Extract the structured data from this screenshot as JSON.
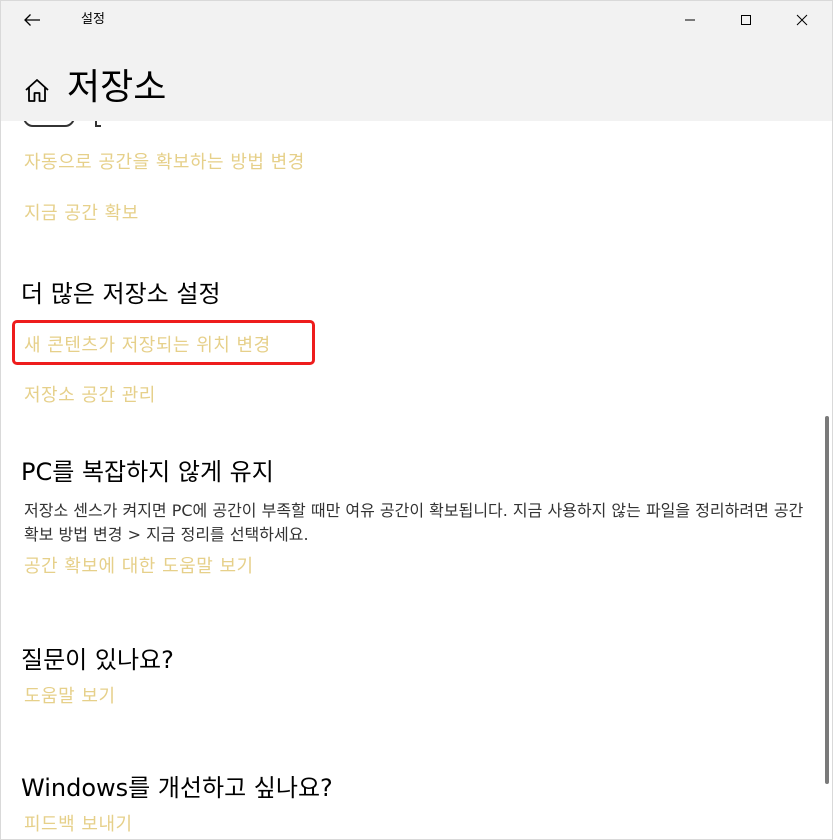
{
  "window": {
    "title": "설정"
  },
  "header": {
    "title": "저장소"
  },
  "sections": {
    "storage_sense": {
      "link_change": "자동으로 공간을 확보하는 방법 변경",
      "link_free_now": "지금 공간 확보"
    },
    "more_settings": {
      "heading": "더 많은 저장소 설정",
      "link_change_location": "새 콘텐츠가 저장되는 위치 변경",
      "link_manage_spaces": "저장소 공간 관리"
    },
    "keep_pc": {
      "heading": "PC를 복잡하지 않게 유지",
      "description": "저장소 센스가 켜지면 PC에 공간이 부족할 때만 여유 공간이 확보됩니다. 지금 사용하지 않는 파일을 정리하려면 공간 확보 방법 변경 > 지금 정리를 선택하세요.",
      "link_help": "공간 확보에 대한 도움말 보기"
    },
    "questions": {
      "heading": "질문이 있나요?",
      "link_help": "도움말 보기"
    },
    "improve": {
      "heading": "Windows를 개선하고 싶나요?",
      "link_feedback": "피드백 보내기"
    }
  },
  "colors": {
    "link": "#e6d08a",
    "highlight": "#ee1c1c",
    "chrome": "#f2f2f2"
  }
}
